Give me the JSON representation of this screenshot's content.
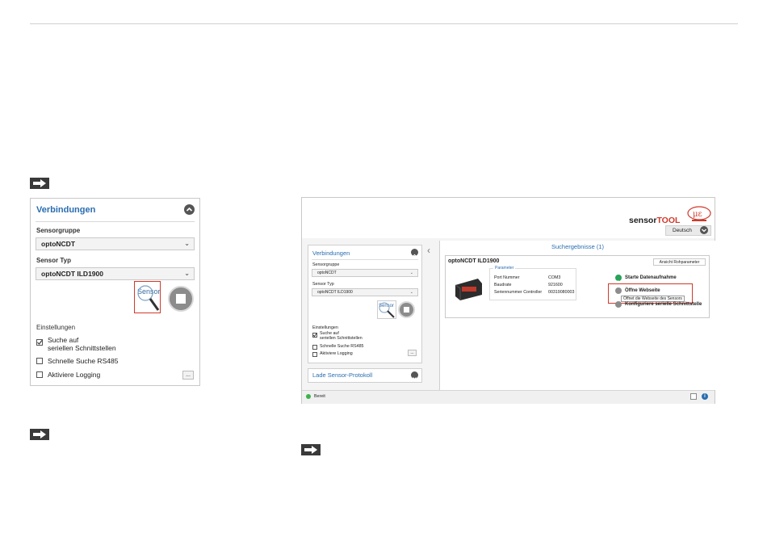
{
  "left_panel": {
    "title": "Verbindungen",
    "sensorgruppe_label": "Sensorgruppe",
    "sensorgruppe_value": "optoNCDT",
    "sensortyp_label": "Sensor Typ",
    "sensortyp_value": "optoNCDT ILD1900",
    "search_button_text": "Sensor",
    "einstellungen_label": "Einstellungen",
    "options": [
      {
        "line1": "Suche auf",
        "line2": "seriellen Schnittstellen",
        "checked": true
      },
      {
        "line1": "Schnelle Suche RS485",
        "line2": "",
        "checked": false
      },
      {
        "line1": "Aktiviere Logging",
        "line2": "",
        "checked": false
      }
    ],
    "more_button": "..."
  },
  "app": {
    "brand_sensor": "sensor",
    "brand_tool": "TOOL",
    "language": "Deutsch",
    "search_results_title": "Suchergebnisse (1)",
    "lade_sensor_protokoll": "Lade Sensor-Protokoll",
    "status": "Bereit",
    "accent": "#2a6db0",
    "brand_red": "#d0392b",
    "inner_panel": {
      "title": "Verbindungen",
      "sensorgruppe_label": "Sensorgruppe",
      "sensorgruppe_value": "optoNCDT",
      "sensortyp_label": "Sensor Typ",
      "sensortyp_value": "optoNCDT ILD1900",
      "search_button_text": "Sensor",
      "einstellungen_label": "Einstellungen",
      "opt1_line1": "Suche auf",
      "opt1_line2": "seriellen Schnittstellen",
      "opt2": "Schnelle Suche RS485",
      "opt3": "Aktiviere Logging",
      "more_button": "..."
    },
    "result": {
      "sensor_name": "optoNCDT ILD1900",
      "raw_params_button": "Ansicht Rohparameter",
      "parameter_group": "Parameter",
      "params": [
        {
          "key": "Port Nummer",
          "value": "COM3"
        },
        {
          "key": "Baudrate",
          "value": "921600"
        },
        {
          "key": "Seriennummer Controller",
          "value": "00319080003"
        }
      ],
      "action_start": "Starte Datenaufnahme",
      "action_open_web": "Öffne Webseite",
      "tooltip": "Öffnet die Webseite des Sensors",
      "action_config": "Konfiguriere serielle Schnittstelle"
    }
  }
}
